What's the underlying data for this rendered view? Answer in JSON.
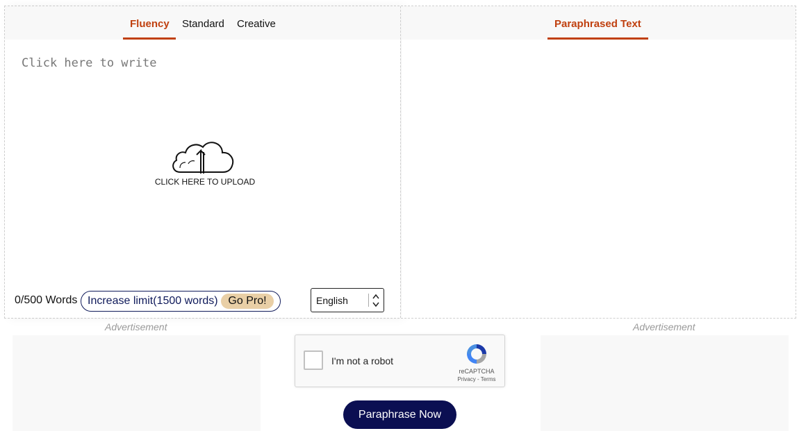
{
  "left_tabs": [
    {
      "label": "Fluency",
      "active": true
    },
    {
      "label": "Standard",
      "active": false
    },
    {
      "label": "Creative",
      "active": false
    }
  ],
  "right_tab": {
    "label": "Paraphrased Text",
    "active": true
  },
  "input": {
    "placeholder": "Click here to write"
  },
  "upload": {
    "label": "CLICK HERE TO UPLOAD",
    "icon": "cloud-upload-icon"
  },
  "footer": {
    "word_count": "0/500 Words",
    "increase_limit": "Increase limit(1500 words)",
    "go_pro": "Go Pro!",
    "language": "English"
  },
  "ads": {
    "left_label": "Advertisement",
    "right_label": "Advertisement"
  },
  "captcha": {
    "label": "I'm not a robot",
    "brand": "reCAPTCHA",
    "links": "Privacy - Terms"
  },
  "submit_button": "Paraphrase Now",
  "colors": {
    "accent": "#c0400f",
    "primary": "#0b0f52",
    "pro_badge": "#e9cfa6"
  }
}
